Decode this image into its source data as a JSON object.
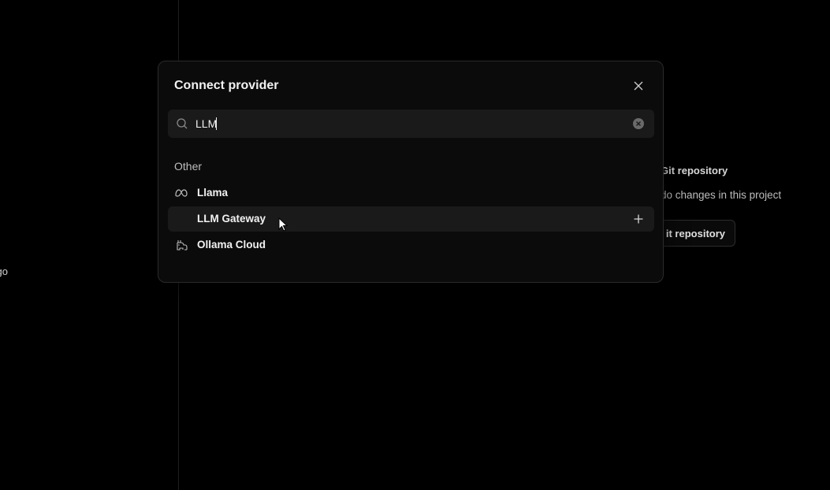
{
  "background": {
    "sidebar_fragment": "go",
    "git_title": "Git repository",
    "git_description": "do changes in this project",
    "git_button_label": "it repository"
  },
  "dialog": {
    "title": "Connect provider",
    "search": {
      "value": "LLM"
    },
    "section_label": "Other",
    "providers": [
      {
        "name": "Llama",
        "icon": "meta-icon"
      },
      {
        "name": "LLM Gateway",
        "icon": "",
        "hovered": true
      },
      {
        "name": "Ollama Cloud",
        "icon": "ollama-icon"
      }
    ]
  },
  "colors": {
    "background": "#000000",
    "dialog": "#0b0b0b",
    "field": "#1a1a1a",
    "text": "#f2f2f2"
  }
}
